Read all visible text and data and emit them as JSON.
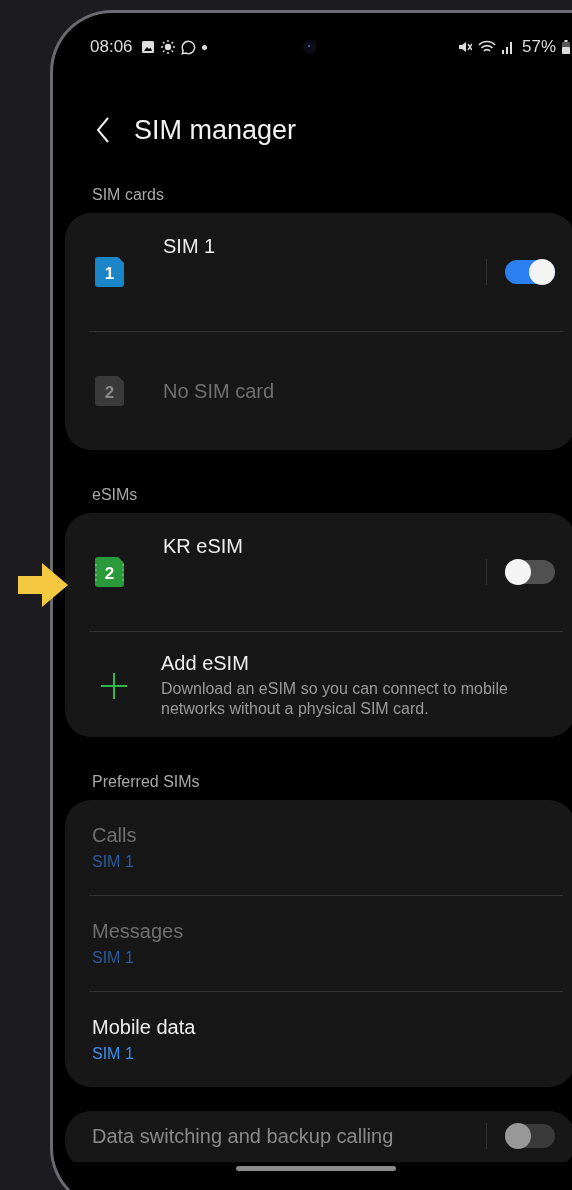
{
  "status_bar": {
    "time": "08:06",
    "battery": "57%"
  },
  "title": "SIM manager",
  "sections": [
    {
      "header": "SIM cards",
      "items": [
        {
          "kind": "sim",
          "badge": "1",
          "name": "SIM 1",
          "color": "#1a86c8",
          "disabled": false,
          "on": true
        },
        {
          "kind": "sim",
          "badge": "2",
          "name": "No SIM card",
          "color": "#3a3a3a",
          "disabled": true
        }
      ]
    },
    {
      "header": "eSIMs",
      "items": [
        {
          "kind": "esim",
          "badge": "2",
          "name": "KR eSIM",
          "color": "#2a9a3a",
          "disabled": false,
          "on": false
        },
        {
          "kind": "add",
          "name": "Add eSIM",
          "description": "Download an eSIM so you can connect to mobile networks without a physical SIM card."
        }
      ]
    },
    {
      "header": "Preferred SIMs",
      "items": [
        {
          "kind": "preference",
          "name": "Calls",
          "value": "SIM 1",
          "disabled": true
        },
        {
          "kind": "preference",
          "name": "Messages",
          "value": "SIM 1",
          "disabled": true
        },
        {
          "kind": "preference",
          "name": "Mobile data",
          "value": "SIM 1",
          "disabled": false
        }
      ]
    },
    {
      "items": [
        {
          "kind": "switch",
          "name": "Data switching and backup calling",
          "disabled": true,
          "on": false
        }
      ]
    }
  ]
}
